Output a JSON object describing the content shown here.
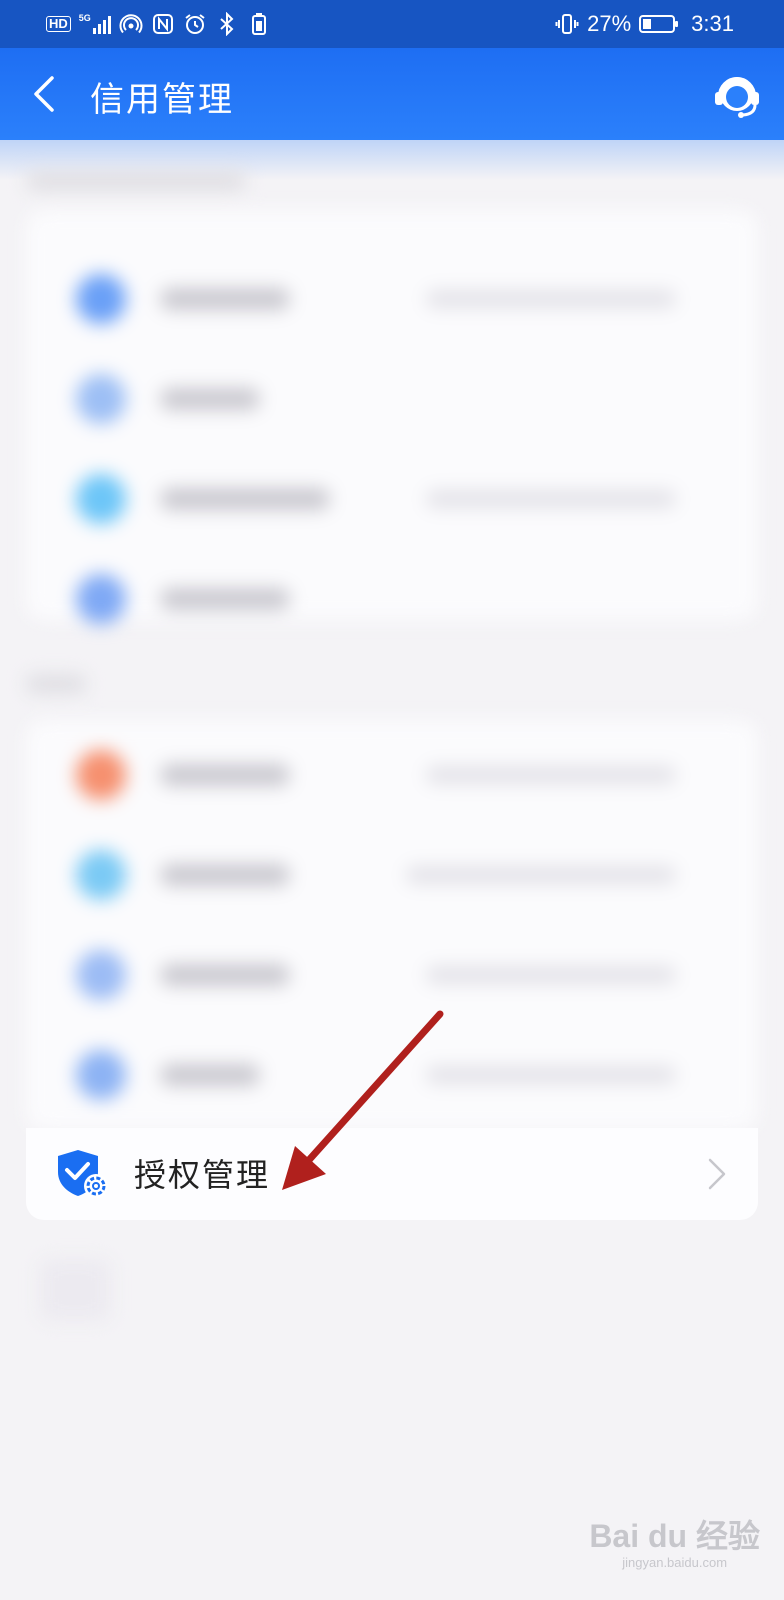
{
  "status_bar": {
    "hd": "HD",
    "network": "5G",
    "battery_percent": "27%",
    "battery_level": 0.27,
    "time": "3:31",
    "icons": [
      "hd-icon",
      "signal-5g-icon",
      "hotspot-icon",
      "nfc-icon",
      "alarm-icon",
      "bluetooth-icon",
      "vibrate-icon",
      "battery-icon"
    ]
  },
  "nav": {
    "title": "信用管理",
    "back_icon": "chevron-left-icon",
    "service_icon": "customer-service-icon"
  },
  "auth_row": {
    "label": "授权管理",
    "icon": "shield-check-gear-icon",
    "chevron": "chevron-right-icon"
  },
  "watermark": {
    "logo": "Bai du 经验",
    "sub": "jingyan.baidu.com"
  },
  "colors": {
    "status_bar": "#1755c2",
    "nav_bar": "#2377f7",
    "background": "#f4f3f6",
    "shield": "#1a6ef2",
    "arrow": "#b0201d"
  }
}
